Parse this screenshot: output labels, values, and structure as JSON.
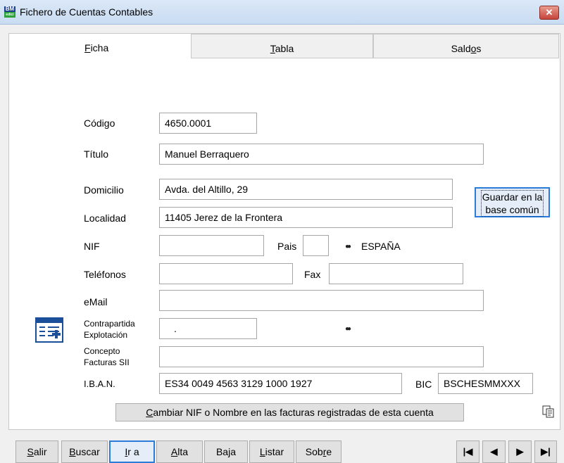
{
  "window": {
    "title": "Fichero de Cuentas Contables",
    "icon_text": "BM",
    "icon_sub": "edici"
  },
  "tabs": [
    {
      "label": "Ficha",
      "accel": "F",
      "rest": "icha"
    },
    {
      "label": "Tabla",
      "accel": "T",
      "rest": "abla"
    },
    {
      "label": "Saldos",
      "pre": "Sald",
      "accel": "o",
      "post": "s"
    }
  ],
  "form": {
    "codigo": {
      "label": "Código",
      "value": "4650.0001"
    },
    "titulo": {
      "label": "Título",
      "value": "Manuel Berraquero"
    },
    "domicilio": {
      "label": "Domicilio",
      "value": "Avda. del Altillo, 29"
    },
    "localidad": {
      "label": "Localidad",
      "value": "11405 Jerez de la Frontera"
    },
    "nif": {
      "label": "NIF",
      "value": ""
    },
    "pais": {
      "label": "Pais",
      "value": "",
      "country": "ESPAÑA"
    },
    "telefonos": {
      "label": "Teléfonos",
      "value": ""
    },
    "fax": {
      "label": "Fax",
      "value": ""
    },
    "email": {
      "label": "eMail",
      "value": ""
    },
    "contrapartida": {
      "label_line1": "Contrapartida",
      "label_line2": "Explotación",
      "value": "."
    },
    "concepto": {
      "label_line1": "Concepto",
      "label_line2": "Facturas SII",
      "value": ""
    },
    "iban": {
      "label": "I.B.A.N.",
      "value": "ES34 0049 4563 3129 1000 1927"
    },
    "bic": {
      "label": "BIC",
      "value": "BSCHESMMXXX"
    }
  },
  "guardar_button": {
    "line1": "Guardar en la",
    "line2": "base común"
  },
  "cambiar_button": {
    "accel": "C",
    "rest": "ambiar NIF o Nombre en las facturas registradas de esta cuenta"
  },
  "bottom_buttons": [
    {
      "accel": "S",
      "rest": "alir"
    },
    {
      "accel": "B",
      "rest": "uscar"
    },
    {
      "accel": "I",
      "rest": "r a"
    },
    {
      "accel": "A",
      "rest": "lta"
    },
    {
      "pre": "Ba",
      "accel": "j",
      "rest": "a"
    },
    {
      "accel": "L",
      "rest": "istar"
    },
    {
      "pre": "Sob",
      "accel": "r",
      "rest": "e"
    }
  ],
  "nav": {
    "first": "first-record",
    "prev": "previous-record",
    "next": "next-record",
    "last": "last-record"
  }
}
